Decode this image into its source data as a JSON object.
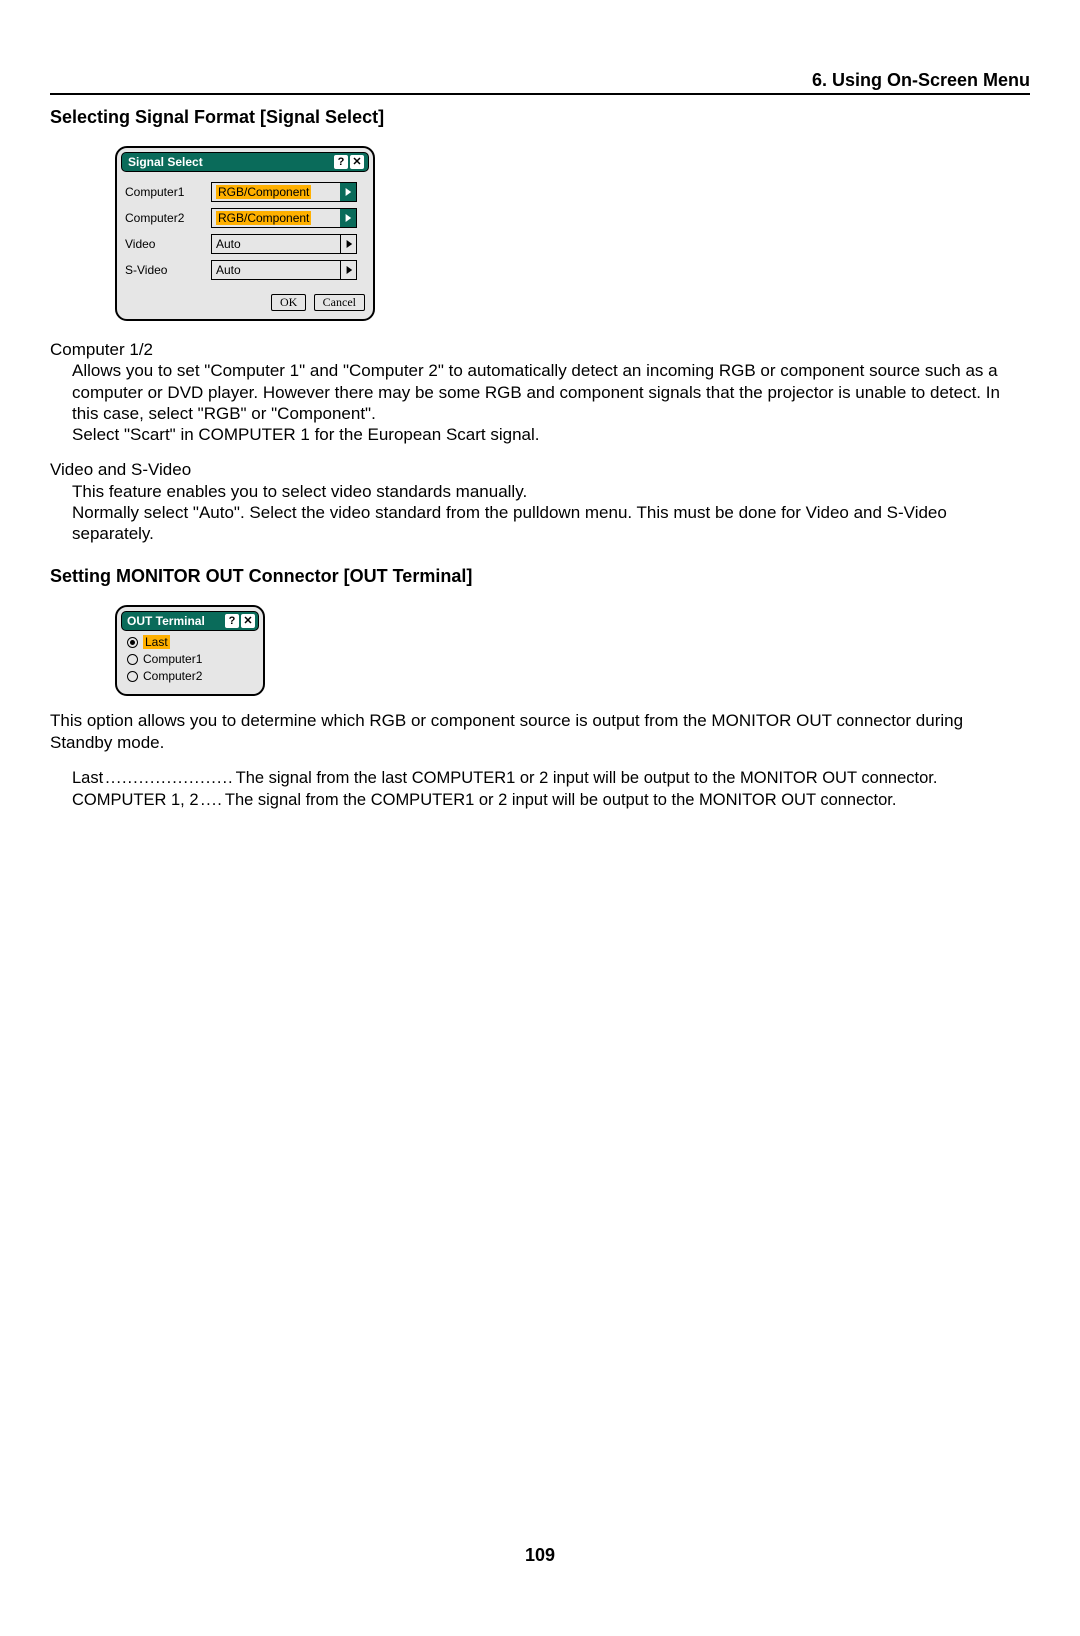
{
  "header": {
    "chapter": "6. Using On-Screen Menu"
  },
  "section1": {
    "title": "Selecting Signal Format [Signal Select]",
    "panel": {
      "title": "Signal Select",
      "rows": [
        {
          "label": "Computer1",
          "value": "RGB/Component",
          "highlighted": true
        },
        {
          "label": "Computer2",
          "value": "RGB/Component",
          "highlighted": true
        },
        {
          "label": "Video",
          "value": "Auto",
          "highlighted": false
        },
        {
          "label": "S-Video",
          "value": "Auto",
          "highlighted": false
        }
      ],
      "ok": "OK",
      "cancel": "Cancel"
    },
    "para1_label": "Computer 1/2",
    "para1_l1": "Allows you to set \"Computer 1\" and \"Computer 2\" to automatically detect an incoming RGB or component source such as a computer or DVD player. However there may be some RGB and component signals that the projector is unable to detect. In this case, select \"RGB\" or \"Component\".",
    "para1_l2": "Select \"Scart\" in COMPUTER 1 for the European Scart signal.",
    "para2_label": "Video and S-Video",
    "para2_l1": "This feature enables you to select video standards manually.",
    "para2_l2": "Normally select \"Auto\". Select the video standard from the pulldown menu. This must be done for Video and S-Video separately."
  },
  "section2": {
    "title": "Setting MONITOR OUT Connector [OUT Terminal]",
    "panel": {
      "title": "OUT Terminal",
      "options": [
        {
          "label": "Last",
          "checked": true
        },
        {
          "label": "Computer1",
          "checked": false
        },
        {
          "label": "Computer2",
          "checked": false
        }
      ]
    },
    "intro": "This option allows you to determine which RGB or component source is output from the MONITOR OUT connector during Standby mode.",
    "defs": [
      {
        "label": "Last",
        "dots": ".......................",
        "text": "The signal from the last COMPUTER1 or 2 input will be output to the MONITOR OUT connector."
      },
      {
        "label": "COMPUTER 1, 2",
        "dots": "....",
        "text": "The signal from the COMPUTER1 or 2 input will be output to the MONITOR OUT connector."
      }
    ]
  },
  "page": "109"
}
